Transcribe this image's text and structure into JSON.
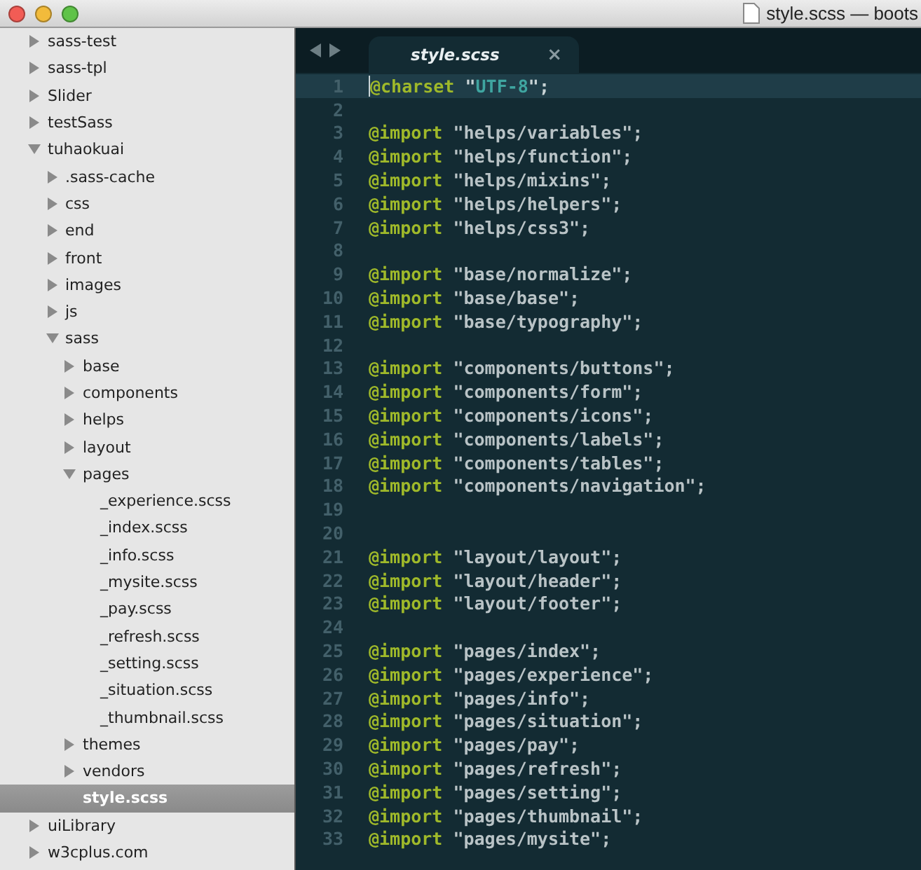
{
  "window": {
    "title": "style.scss — boots"
  },
  "sidebar": {
    "items": [
      {
        "label": "sass-test",
        "kind": "folder",
        "expanded": false,
        "selected": false
      },
      {
        "label": "sass-tpl",
        "kind": "folder",
        "expanded": false,
        "selected": false
      },
      {
        "label": "Slider",
        "kind": "folder",
        "expanded": false,
        "selected": false
      },
      {
        "label": "testSass",
        "kind": "folder",
        "expanded": false,
        "selected": false
      },
      {
        "label": "tuhaokuai",
        "kind": "folder",
        "expanded": true,
        "selected": false,
        "children": [
          {
            "label": ".sass-cache",
            "kind": "folder",
            "expanded": false,
            "selected": false
          },
          {
            "label": "css",
            "kind": "folder",
            "expanded": false,
            "selected": false
          },
          {
            "label": "end",
            "kind": "folder",
            "expanded": false,
            "selected": false
          },
          {
            "label": "front",
            "kind": "folder",
            "expanded": false,
            "selected": false
          },
          {
            "label": "images",
            "kind": "folder",
            "expanded": false,
            "selected": false
          },
          {
            "label": "js",
            "kind": "folder",
            "expanded": false,
            "selected": false
          },
          {
            "label": "sass",
            "kind": "folder",
            "expanded": true,
            "selected": false,
            "children": [
              {
                "label": "base",
                "kind": "folder",
                "expanded": false,
                "selected": false
              },
              {
                "label": "components",
                "kind": "folder",
                "expanded": false,
                "selected": false
              },
              {
                "label": "helps",
                "kind": "folder",
                "expanded": false,
                "selected": false
              },
              {
                "label": "layout",
                "kind": "folder",
                "expanded": false,
                "selected": false
              },
              {
                "label": "pages",
                "kind": "folder",
                "expanded": true,
                "selected": false,
                "children": [
                  {
                    "label": "_experience.scss",
                    "kind": "file",
                    "selected": false
                  },
                  {
                    "label": "_index.scss",
                    "kind": "file",
                    "selected": false
                  },
                  {
                    "label": "_info.scss",
                    "kind": "file",
                    "selected": false
                  },
                  {
                    "label": "_mysite.scss",
                    "kind": "file",
                    "selected": false
                  },
                  {
                    "label": "_pay.scss",
                    "kind": "file",
                    "selected": false
                  },
                  {
                    "label": "_refresh.scss",
                    "kind": "file",
                    "selected": false
                  },
                  {
                    "label": "_setting.scss",
                    "kind": "file",
                    "selected": false
                  },
                  {
                    "label": "_situation.scss",
                    "kind": "file",
                    "selected": false
                  },
                  {
                    "label": "_thumbnail.scss",
                    "kind": "file",
                    "selected": false
                  }
                ]
              },
              {
                "label": "themes",
                "kind": "folder",
                "expanded": false,
                "selected": false
              },
              {
                "label": "vendors",
                "kind": "folder",
                "expanded": false,
                "selected": false
              },
              {
                "label": "style.scss",
                "kind": "file",
                "selected": true
              }
            ]
          }
        ]
      },
      {
        "label": "uiLibrary",
        "kind": "folder",
        "expanded": false,
        "selected": false
      },
      {
        "label": "w3cplus.com",
        "kind": "folder",
        "expanded": false,
        "selected": false
      }
    ]
  },
  "tabs": [
    {
      "label": "style.scss",
      "close": "×",
      "selected": true
    }
  ],
  "editor": {
    "lines": [
      {
        "number": "1",
        "current": true,
        "tokens": [
          {
            "text": "@charset",
            "kind": "keyword"
          },
          {
            "text": " \"",
            "kind": "punct"
          },
          {
            "text": "UTF-8",
            "kind": "constant"
          },
          {
            "text": "\";",
            "kind": "punct"
          }
        ]
      },
      {
        "number": "2",
        "current": false
      },
      {
        "number": "3",
        "current": false,
        "tokens": [
          {
            "text": "@import",
            "kind": "keyword"
          },
          {
            "text": " \"helps/variables\";",
            "kind": "string"
          }
        ]
      },
      {
        "number": "4",
        "current": false,
        "tokens": [
          {
            "text": "@import",
            "kind": "keyword"
          },
          {
            "text": " \"helps/function\";",
            "kind": "string"
          }
        ]
      },
      {
        "number": "5",
        "current": false,
        "tokens": [
          {
            "text": "@import",
            "kind": "keyword"
          },
          {
            "text": " \"helps/mixins\";",
            "kind": "string"
          }
        ]
      },
      {
        "number": "6",
        "current": false,
        "tokens": [
          {
            "text": "@import",
            "kind": "keyword"
          },
          {
            "text": " \"helps/helpers\";",
            "kind": "string"
          }
        ]
      },
      {
        "number": "7",
        "current": false,
        "tokens": [
          {
            "text": "@import",
            "kind": "keyword"
          },
          {
            "text": " \"helps/css3\";",
            "kind": "string"
          }
        ]
      },
      {
        "number": "8",
        "current": false
      },
      {
        "number": "9",
        "current": false,
        "tokens": [
          {
            "text": "@import",
            "kind": "keyword"
          },
          {
            "text": " \"base/normalize\";",
            "kind": "string"
          }
        ]
      },
      {
        "number": "10",
        "current": false,
        "tokens": [
          {
            "text": "@import",
            "kind": "keyword"
          },
          {
            "text": " \"base/base\";",
            "kind": "string"
          }
        ]
      },
      {
        "number": "11",
        "current": false,
        "tokens": [
          {
            "text": "@import",
            "kind": "keyword"
          },
          {
            "text": " \"base/typography\";",
            "kind": "string"
          }
        ]
      },
      {
        "number": "12",
        "current": false
      },
      {
        "number": "13",
        "current": false,
        "tokens": [
          {
            "text": "@import",
            "kind": "keyword"
          },
          {
            "text": " \"components/buttons\";",
            "kind": "string"
          }
        ]
      },
      {
        "number": "14",
        "current": false,
        "tokens": [
          {
            "text": "@import",
            "kind": "keyword"
          },
          {
            "text": " \"components/form\";",
            "kind": "string"
          }
        ]
      },
      {
        "number": "15",
        "current": false,
        "tokens": [
          {
            "text": "@import",
            "kind": "keyword"
          },
          {
            "text": " \"components/icons\";",
            "kind": "string"
          }
        ]
      },
      {
        "number": "16",
        "current": false,
        "tokens": [
          {
            "text": "@import",
            "kind": "keyword"
          },
          {
            "text": " \"components/labels\";",
            "kind": "string"
          }
        ]
      },
      {
        "number": "17",
        "current": false,
        "tokens": [
          {
            "text": "@import",
            "kind": "keyword"
          },
          {
            "text": " \"components/tables\";",
            "kind": "string"
          }
        ]
      },
      {
        "number": "18",
        "current": false,
        "tokens": [
          {
            "text": "@import",
            "kind": "keyword"
          },
          {
            "text": " \"components/navigation\";",
            "kind": "string"
          }
        ]
      },
      {
        "number": "19",
        "current": false
      },
      {
        "number": "20",
        "current": false
      },
      {
        "number": "21",
        "current": false,
        "tokens": [
          {
            "text": "@import",
            "kind": "keyword"
          },
          {
            "text": " \"layout/layout\";",
            "kind": "string"
          }
        ]
      },
      {
        "number": "22",
        "current": false,
        "tokens": [
          {
            "text": "@import",
            "kind": "keyword"
          },
          {
            "text": " \"layout/header\";",
            "kind": "string"
          }
        ]
      },
      {
        "number": "23",
        "current": false,
        "tokens": [
          {
            "text": "@import",
            "kind": "keyword"
          },
          {
            "text": " \"layout/footer\";",
            "kind": "string"
          }
        ]
      },
      {
        "number": "24",
        "current": false
      },
      {
        "number": "25",
        "current": false,
        "tokens": [
          {
            "text": "@import",
            "kind": "keyword"
          },
          {
            "text": " \"pages/index\";",
            "kind": "string"
          }
        ]
      },
      {
        "number": "26",
        "current": false,
        "tokens": [
          {
            "text": "@import",
            "kind": "keyword"
          },
          {
            "text": " \"pages/experience\";",
            "kind": "string"
          }
        ]
      },
      {
        "number": "27",
        "current": false,
        "tokens": [
          {
            "text": "@import",
            "kind": "keyword"
          },
          {
            "text": " \"pages/info\";",
            "kind": "string"
          }
        ]
      },
      {
        "number": "28",
        "current": false,
        "tokens": [
          {
            "text": "@import",
            "kind": "keyword"
          },
          {
            "text": " \"pages/situation\";",
            "kind": "string"
          }
        ]
      },
      {
        "number": "29",
        "current": false,
        "tokens": [
          {
            "text": "@import",
            "kind": "keyword"
          },
          {
            "text": " \"pages/pay\";",
            "kind": "string"
          }
        ]
      },
      {
        "number": "30",
        "current": false,
        "tokens": [
          {
            "text": "@import",
            "kind": "keyword"
          },
          {
            "text": " \"pages/refresh\";",
            "kind": "string"
          }
        ]
      },
      {
        "number": "31",
        "current": false,
        "tokens": [
          {
            "text": "@import",
            "kind": "keyword"
          },
          {
            "text": " \"pages/setting\";",
            "kind": "string"
          }
        ]
      },
      {
        "number": "32",
        "current": false,
        "tokens": [
          {
            "text": "@import",
            "kind": "keyword"
          },
          {
            "text": " \"pages/thumbnail\";",
            "kind": "string"
          }
        ]
      },
      {
        "number": "33",
        "current": false,
        "tokens": [
          {
            "text": "@import",
            "kind": "keyword"
          },
          {
            "text": " \"pages/mysite\";",
            "kind": "string"
          }
        ]
      }
    ]
  }
}
